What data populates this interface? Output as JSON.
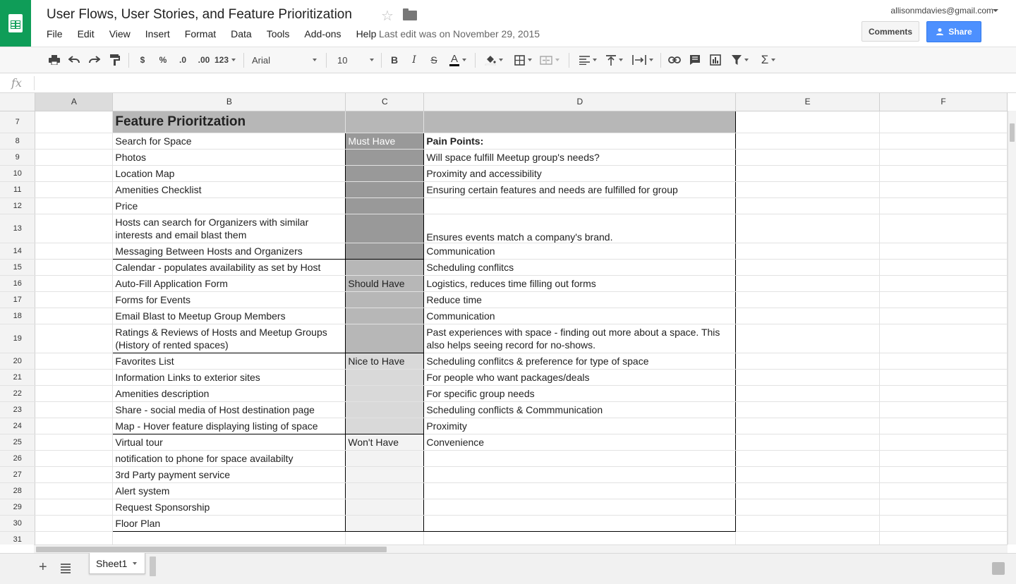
{
  "document": {
    "title": "User Flows, User Stories, and Feature Prioritization",
    "last_edit": "Last edit was on November 29, 2015"
  },
  "account": {
    "email": "allisonmdavies@gmail.com"
  },
  "buttons": {
    "comments": "Comments",
    "share": "Share"
  },
  "menu": [
    "File",
    "Edit",
    "View",
    "Insert",
    "Format",
    "Data",
    "Tools",
    "Add-ons",
    "Help"
  ],
  "toolbar": {
    "currency": "$",
    "percent": "%",
    "decrease_decimals": ".0",
    "increase_decimals": ".00",
    "more_formats": "123",
    "font": "Arial",
    "font_size": "10",
    "bold": "B",
    "italic": "I",
    "strikethrough": "S",
    "text_color": "A",
    "functions": "Σ"
  },
  "formula_bar": {
    "fx": "fx",
    "value": ""
  },
  "columns": [
    "A",
    "B",
    "C",
    "D",
    "E",
    "F"
  ],
  "rows": [
    {
      "n": "7",
      "b": "Feature Prioritzation",
      "c": "",
      "d": ""
    },
    {
      "n": "8",
      "b": "Search for Space",
      "c": "Must Have",
      "d": "Pain Points:"
    },
    {
      "n": "9",
      "b": "Photos",
      "c": "",
      "d": "Will space fulfill Meetup group's needs?"
    },
    {
      "n": "10",
      "b": "Location Map",
      "c": "",
      "d": "Proximity and accessibility"
    },
    {
      "n": "11",
      "b": "Amenities Checklist",
      "c": "",
      "d": "Ensuring certain features and needs are fulfilled for group"
    },
    {
      "n": "12",
      "b": "Price",
      "c": "",
      "d": ""
    },
    {
      "n": "13",
      "b": "Hosts can search for Organizers with similar interests and email blast them",
      "c": "",
      "d": "Ensures events match a company's brand."
    },
    {
      "n": "14",
      "b": "Messaging Between Hosts and Organizers",
      "c": "",
      "d": "Communication"
    },
    {
      "n": "15",
      "b": "Calendar - populates availability as set by Host",
      "c": "",
      "d": "Scheduling conflitcs"
    },
    {
      "n": "16",
      "b": "Auto-Fill Application Form",
      "c": "Should Have",
      "d": "Logistics, reduces time filling out forms"
    },
    {
      "n": "17",
      "b": "Forms for Events",
      "c": "",
      "d": "Reduce time"
    },
    {
      "n": "18",
      "b": "Email Blast to Meetup Group Members",
      "c": "",
      "d": "Communication"
    },
    {
      "n": "19",
      "b": "Ratings & Reviews of Hosts and Meetup Groups (History of rented spaces)",
      "c": "",
      "d": "Past experiences with space - finding out more about a space. This also helps seeing record for no-shows."
    },
    {
      "n": "20",
      "b": "Favorites List",
      "c": "Nice to Have",
      "d": "Scheduling conflitcs & preference for type of space"
    },
    {
      "n": "21",
      "b": "Information Links to exterior sites",
      "c": "",
      "d": "For people who want packages/deals"
    },
    {
      "n": "22",
      "b": "Amenities description",
      "c": "",
      "d": "For specific group needs"
    },
    {
      "n": "23",
      "b": "Share - social media of Host destination page",
      "c": "",
      "d": "Scheduling conflicts & Commmunication"
    },
    {
      "n": "24",
      "b": "Map - Hover feature displaying listing of space",
      "c": "",
      "d": "Proximity"
    },
    {
      "n": "25",
      "b": "Virtual tour",
      "c": "Won't Have",
      "d": "Convenience"
    },
    {
      "n": "26",
      "b": "notification to phone for space availabilty",
      "c": "",
      "d": ""
    },
    {
      "n": "27",
      "b": "3rd Party payment service",
      "c": "",
      "d": ""
    },
    {
      "n": "28",
      "b": "Alert system",
      "c": "",
      "d": ""
    },
    {
      "n": "29",
      "b": "Request Sponsorship",
      "c": "",
      "d": ""
    },
    {
      "n": "30",
      "b": "Floor Plan",
      "c": "",
      "d": ""
    },
    {
      "n": "31",
      "b": "",
      "c": "",
      "d": ""
    }
  ],
  "sheets": [
    {
      "name": "Sheet1"
    }
  ],
  "colors": {
    "brand": "#0f9d58",
    "share": "#4d90fe",
    "title_fill": "#b7b7b7",
    "must_have": "#999999",
    "should_have": "#b7b7b7",
    "nice_to_have": "#d9d9d9",
    "wont_have": "#f3f3f3"
  }
}
